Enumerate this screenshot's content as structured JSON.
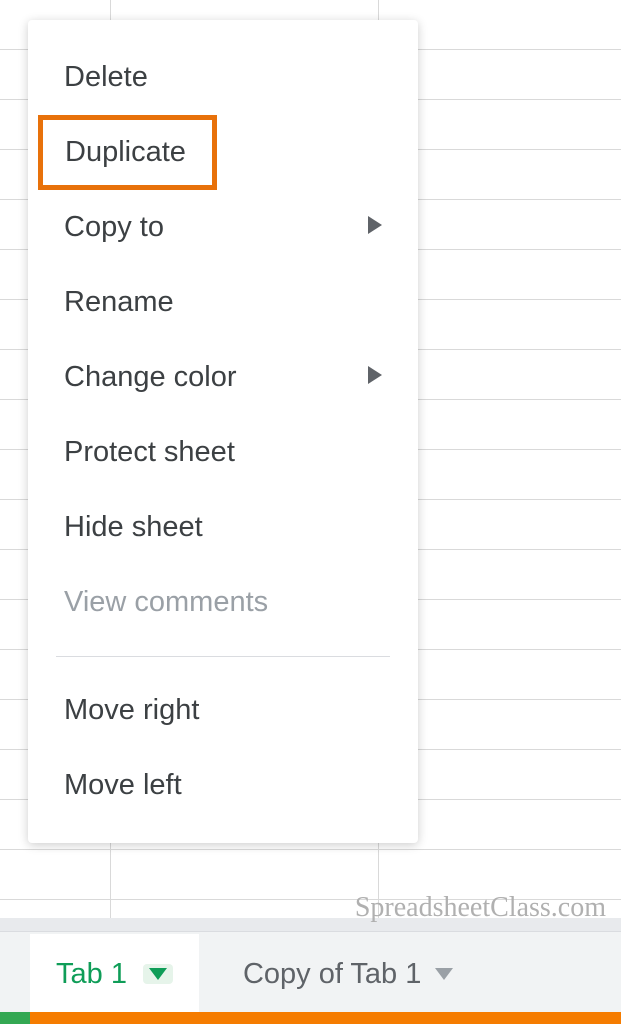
{
  "contextMenu": {
    "items": [
      {
        "label": "Delete",
        "hasSubmenu": false,
        "disabled": false
      },
      {
        "label": "Duplicate",
        "hasSubmenu": false,
        "disabled": false,
        "highlighted": true
      },
      {
        "label": "Copy to",
        "hasSubmenu": true,
        "disabled": false
      },
      {
        "label": "Rename",
        "hasSubmenu": false,
        "disabled": false
      },
      {
        "label": "Change color",
        "hasSubmenu": true,
        "disabled": false
      },
      {
        "label": "Protect sheet",
        "hasSubmenu": false,
        "disabled": false
      },
      {
        "label": "Hide sheet",
        "hasSubmenu": false,
        "disabled": false
      },
      {
        "label": "View comments",
        "hasSubmenu": false,
        "disabled": true
      }
    ],
    "secondaryItems": [
      {
        "label": "Move right"
      },
      {
        "label": "Move left"
      }
    ]
  },
  "tabs": {
    "active": {
      "label": "Tab 1"
    },
    "inactive": {
      "label": "Copy of Tab 1"
    }
  },
  "watermark": "SpreadsheetClass.com"
}
